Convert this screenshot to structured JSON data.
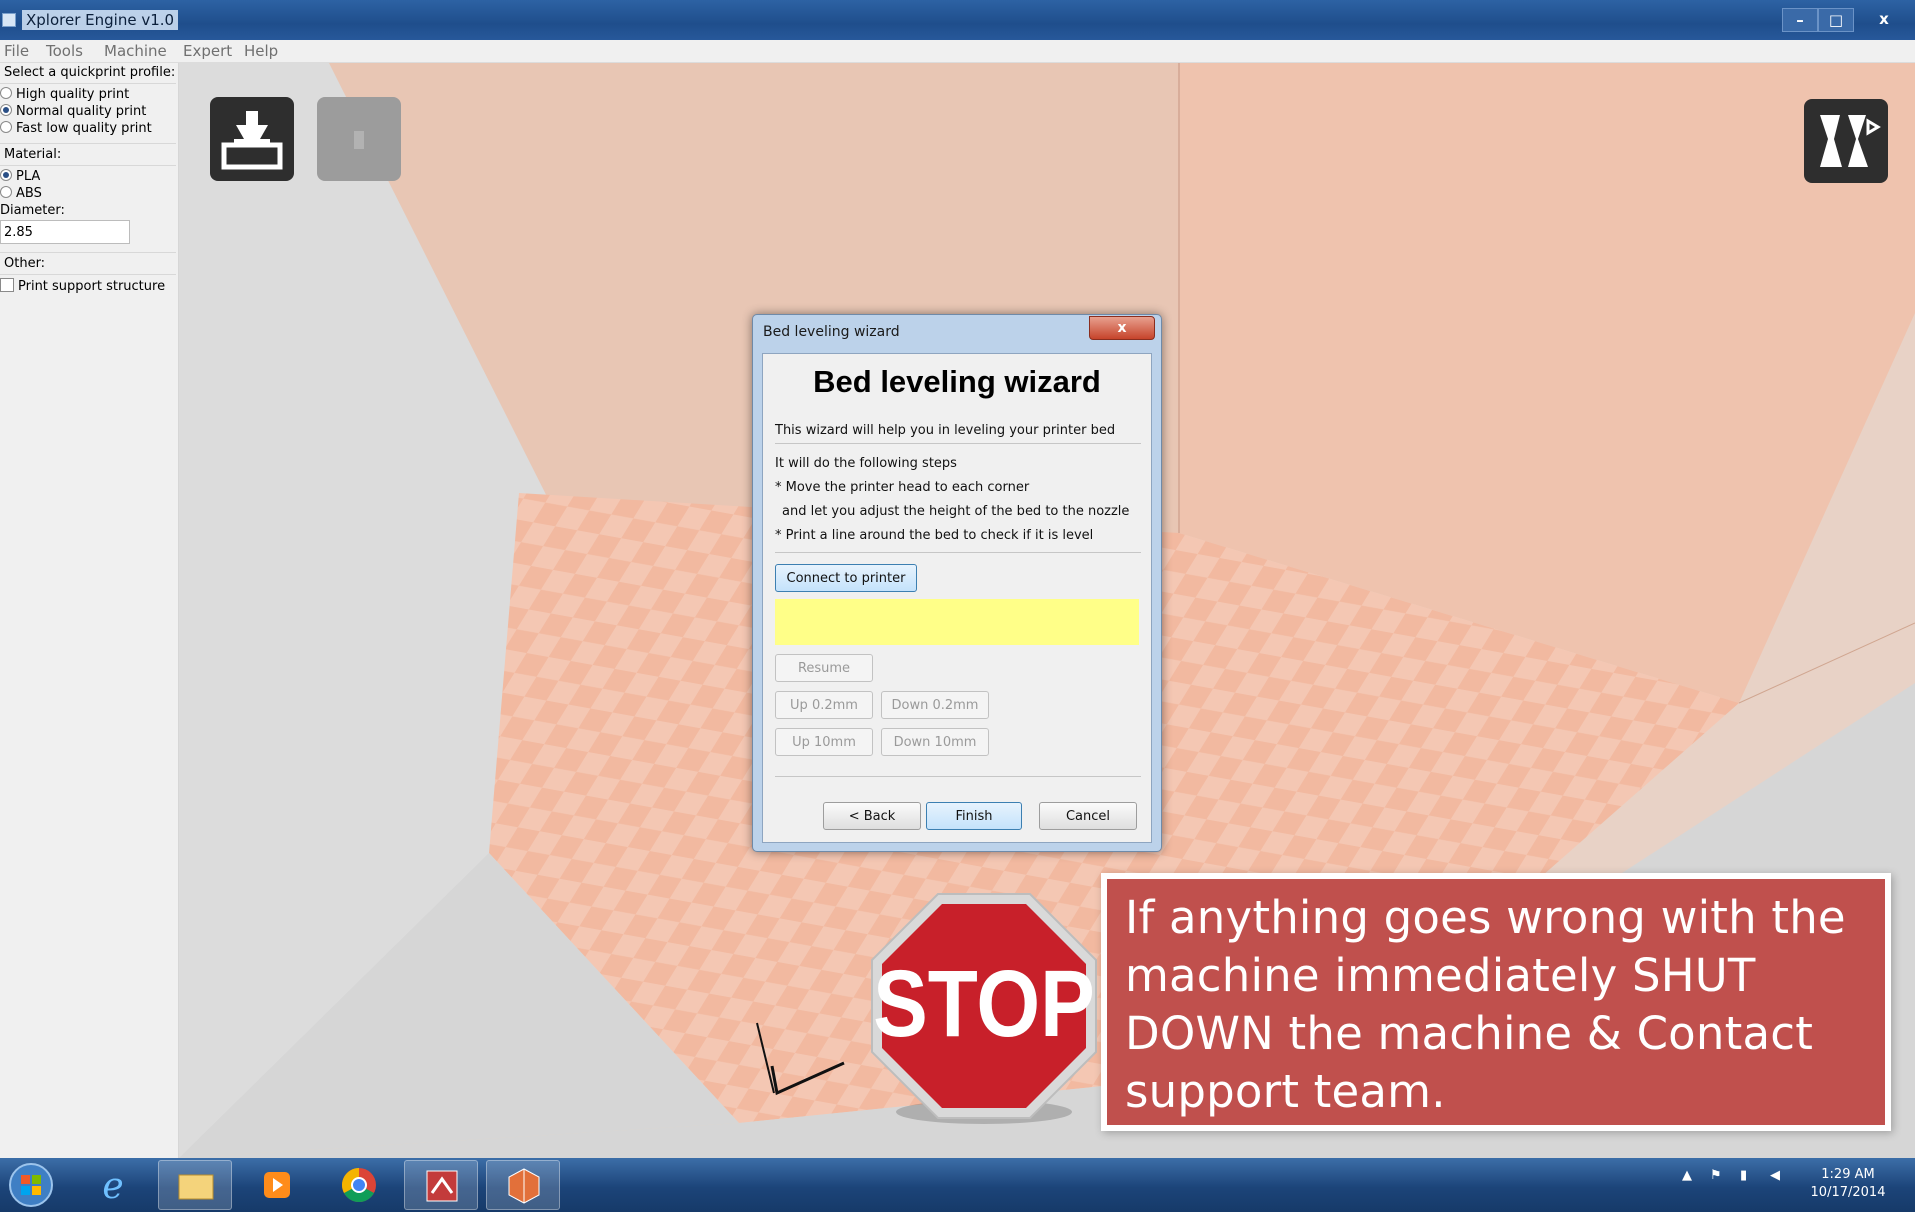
{
  "window": {
    "title": "Xplorer Engine v1.0",
    "min_glyph": "–",
    "max_glyph": "□",
    "close_glyph": "x"
  },
  "menu": [
    "File",
    "Tools",
    "Machine",
    "Expert",
    "Help"
  ],
  "left_panel": {
    "profile_label": "Select a quickprint profile:",
    "profiles": [
      {
        "label": "High quality print",
        "selected": false
      },
      {
        "label": "Normal quality print",
        "selected": true
      },
      {
        "label": "Fast low quality print",
        "selected": false
      }
    ],
    "material_label": "Material:",
    "materials": [
      {
        "label": "PLA",
        "selected": true
      },
      {
        "label": "ABS",
        "selected": false
      }
    ],
    "diameter_label": "Diameter:",
    "diameter_value": "2.85",
    "other_label": "Other:",
    "support_label": "Print support structure",
    "support_checked": false
  },
  "toolbar": {
    "load_icon": "load-model-icon",
    "print_icon": "print-icon",
    "view_icon": "view-mode-icon"
  },
  "dialog": {
    "window_title": "Bed leveling wizard",
    "close_glyph": "x",
    "heading": "Bed leveling wizard",
    "intro": "This wizard will help you in leveling your printer bed",
    "steps_intro": "It will do the following steps",
    "step1": "* Move the printer head to each corner",
    "step1b": "  and let you adjust the height of the bed to the nozzle",
    "step2": "* Print a line around the bed to check if it is level",
    "connect_label": "Connect to printer",
    "status_text": "",
    "resume_label": "Resume",
    "up02_label": "Up 0.2mm",
    "down02_label": "Down 0.2mm",
    "up10_label": "Up 10mm",
    "down10_label": "Down 10mm",
    "back_label": "< Back",
    "finish_label": "Finish",
    "cancel_label": "Cancel"
  },
  "stop_sign": {
    "text": "STOP"
  },
  "callout": {
    "text": "If anything goes wrong with the machine immediately SHUT DOWN the machine & Contact support team."
  },
  "taskbar": {
    "apps": [
      "start-orb",
      "internet-explorer",
      "file-explorer",
      "media-player",
      "chrome",
      "paint",
      "xplorer-engine"
    ],
    "time": "1:29 AM",
    "date": "10/17/2014"
  },
  "colors": {
    "callout_bg": "#c0504d",
    "stop_red": "#c8202a",
    "status_yellow": "#ffff88"
  }
}
